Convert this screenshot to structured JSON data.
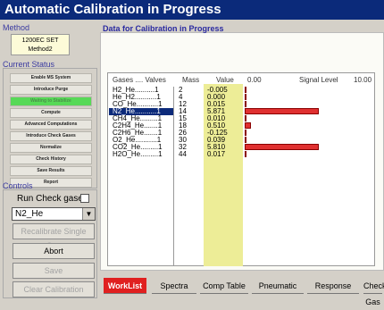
{
  "title": "Automatic Calibration in Progress",
  "method": {
    "label": "Method",
    "line1": "1200EC SET",
    "line2": "Method2"
  },
  "status": {
    "label": "Current Status",
    "items": [
      {
        "label": "Enable MS System",
        "active": false
      },
      {
        "label": "Introduce Purge",
        "active": false
      },
      {
        "label": "Waiting to Stabilize",
        "active": true
      },
      {
        "label": "Compute",
        "active": false
      },
      {
        "label": "Advanced Computations",
        "active": false
      },
      {
        "label": "Introduce Check Gases",
        "active": false
      },
      {
        "label": "Normalize",
        "active": false
      },
      {
        "label": "Check History",
        "active": false
      },
      {
        "label": "Save Results",
        "active": false
      },
      {
        "label": "Report",
        "active": false
      }
    ]
  },
  "controls": {
    "label": "Controls",
    "run_check_label": "Run Check gases:",
    "selected_gas": "N2_He",
    "recalibrate_label": "Recalibrate Single Gas",
    "abort_label": "Abort",
    "save_label": "Save",
    "clear_label": "Clear Calibration"
  },
  "main": {
    "title": "Data for Calibration in Progress",
    "headers": {
      "gases": "Gases .... Valves",
      "mass": "Mass",
      "value": "Value",
      "min": "0.00",
      "signal": "Signal Level",
      "max": "10.00"
    },
    "gases": [
      "H2_He..........1",
      "He_H2...........1",
      "CO_He...........1",
      "N2_He...........1",
      "CH4_He.........1",
      "C2H4_He.......1",
      "C2H6_He.......1",
      "O2_He...........1",
      "CO2_He.........1",
      "H2O_He.........1"
    ],
    "selected_gas_index": 3,
    "rows": [
      {
        "mass": "2",
        "value": "-0.005",
        "signal": -0.005
      },
      {
        "mass": "4",
        "value": "0.000",
        "signal": 0.0
      },
      {
        "mass": "12",
        "value": "0.015",
        "signal": 0.015
      },
      {
        "mass": "14",
        "value": "5.871",
        "signal": 5.871
      },
      {
        "mass": "15",
        "value": "0.010",
        "signal": 0.01
      },
      {
        "mass": "18",
        "value": "0.510",
        "signal": 0.51
      },
      {
        "mass": "26",
        "value": "-0.125",
        "signal": -0.125
      },
      {
        "mass": "30",
        "value": "0.039",
        "signal": 0.039
      },
      {
        "mass": "32",
        "value": "5.810",
        "signal": 5.81
      },
      {
        "mass": "44",
        "value": "0.017",
        "signal": 0.017
      }
    ]
  },
  "tabs": [
    {
      "label": "WorkList",
      "active": true
    },
    {
      "label": "Spectra",
      "active": false
    },
    {
      "label": "Comp Table",
      "active": false
    },
    {
      "label": "Pneumatic",
      "active": false
    },
    {
      "label": "Response",
      "active": false
    },
    {
      "label": "Check Gas",
      "active": false
    }
  ]
}
